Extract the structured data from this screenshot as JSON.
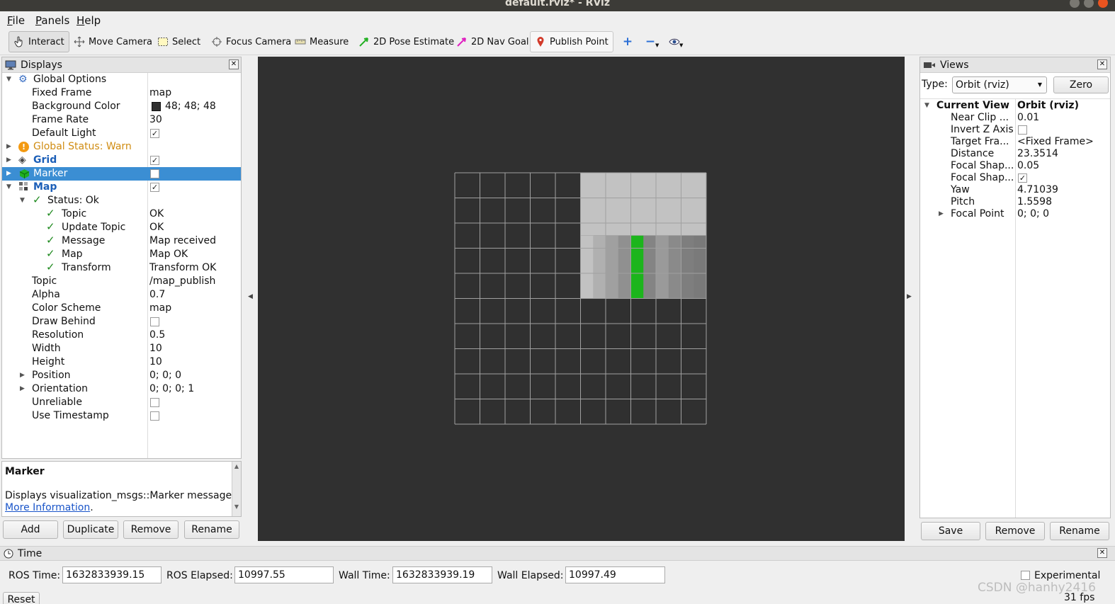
{
  "window": {
    "title": "default.rviz* - RViz"
  },
  "menu": [
    {
      "mnemonic": "F",
      "rest": "ile"
    },
    {
      "mnemonic": "P",
      "rest": "anels"
    },
    {
      "mnemonic": "H",
      "rest": "elp"
    }
  ],
  "toolbar": {
    "interact": "Interact",
    "move_camera": "Move Camera",
    "select": "Select",
    "focus_camera": "Focus Camera",
    "measure": "Measure",
    "pose_estimate": "2D Pose Estimate",
    "nav_goal": "2D Nav Goal",
    "publish_point": "Publish Point"
  },
  "displays": {
    "title": "Displays",
    "rows": {
      "global_options": "Global Options",
      "fixed_frame": {
        "label": "Fixed Frame",
        "value": "map"
      },
      "background_color": {
        "label": "Background Color",
        "value": "48; 48; 48",
        "swatch": "#303030"
      },
      "frame_rate": {
        "label": "Frame Rate",
        "value": "30"
      },
      "default_light": {
        "label": "Default Light",
        "checked": true
      },
      "global_status": "Global Status: Warn",
      "grid": "Grid",
      "marker": "Marker",
      "map": "Map",
      "status_ok": "Status: Ok",
      "topic_status": {
        "label": "Topic",
        "value": "OK"
      },
      "update_topic": {
        "label": "Update Topic",
        "value": "OK"
      },
      "message": {
        "label": "Message",
        "value": "Map received"
      },
      "map_status": {
        "label": "Map",
        "value": "Map OK"
      },
      "transform": {
        "label": "Transform",
        "value": "Transform OK"
      },
      "topic": {
        "label": "Topic",
        "value": "/map_publish"
      },
      "alpha": {
        "label": "Alpha",
        "value": "0.7"
      },
      "color_scheme": {
        "label": "Color Scheme",
        "value": "map"
      },
      "draw_behind": {
        "label": "Draw Behind"
      },
      "resolution": {
        "label": "Resolution",
        "value": "0.5"
      },
      "width": {
        "label": "Width",
        "value": "10"
      },
      "height": {
        "label": "Height",
        "value": "10"
      },
      "position": {
        "label": "Position",
        "value": "0; 0; 0"
      },
      "orientation": {
        "label": "Orientation",
        "value": "0; 0; 0; 1"
      },
      "unreliable": {
        "label": "Unreliable"
      },
      "use_timestamp": {
        "label": "Use Timestamp"
      }
    },
    "description": {
      "title": "Marker",
      "text": "Displays visualization_msgs::Marker messages.",
      "link": "More Information",
      "link_suffix": "."
    },
    "buttons": {
      "add": "Add",
      "duplicate": "Duplicate",
      "remove": "Remove",
      "rename": "Rename"
    }
  },
  "views": {
    "title": "Views",
    "type_label": "Type:",
    "type_value": "Orbit (rviz)",
    "zero": "Zero",
    "current_view": {
      "label": "Current View",
      "value": "Orbit (rviz)"
    },
    "props": [
      {
        "label": "Near Clip ...",
        "value": "0.01"
      },
      {
        "label": "Invert Z Axis",
        "value": ""
      },
      {
        "label": "Target Fra...",
        "value": "<Fixed Frame>"
      },
      {
        "label": "Distance",
        "value": "23.3514"
      },
      {
        "label": "Focal Shap...",
        "value": "0.05"
      },
      {
        "label": "Focal Shap...",
        "value": ""
      },
      {
        "label": "Yaw",
        "value": "4.71039"
      },
      {
        "label": "Pitch",
        "value": "1.5598"
      },
      {
        "label": "Focal Point",
        "value": "0; 0; 0"
      }
    ],
    "buttons": {
      "save": "Save",
      "remove": "Remove",
      "rename": "Rename"
    }
  },
  "time": {
    "title": "Time",
    "ros_time_label": "ROS Time:",
    "ros_time": "1632833939.15",
    "ros_elapsed_label": "ROS Elapsed:",
    "ros_elapsed": "10997.55",
    "wall_time_label": "Wall Time:",
    "wall_time": "1632833939.19",
    "wall_elapsed_label": "Wall Elapsed:",
    "wall_elapsed": "10997.49",
    "experimental": "Experimental",
    "reset": "Reset",
    "fps": "31 fps",
    "watermark": "CSDN @hanhy2416"
  },
  "scene": {
    "colors": {
      "background": "#303030",
      "grid_line": "#a0a0a0",
      "free": "#c2c2c2",
      "marker": "#1cb51c"
    },
    "map_columns": [
      "#c2c2c2",
      "#b0b0b0",
      "#a0a0a0",
      "#909090",
      "#1cb51c",
      "#848484",
      "#9a9a9a",
      "#8a8a8a",
      "#7e7e7e",
      "#7a7a7a"
    ]
  }
}
